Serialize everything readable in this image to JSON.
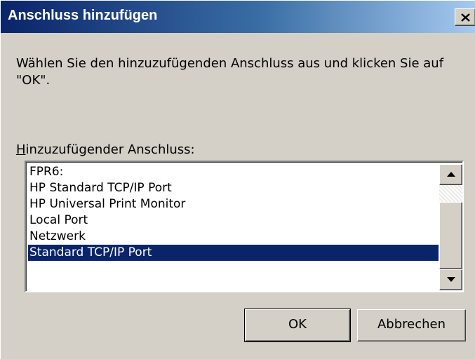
{
  "window": {
    "title": "Anschluss hinzufügen",
    "close_icon": "close-icon"
  },
  "instruction": "Wählen Sie den hinzuzufügenden Anschluss aus und klicken Sie auf \"OK\".",
  "field_label": {
    "mnemonic": "H",
    "rest": "inzuzufügender Anschluss:"
  },
  "ports": {
    "items": [
      "FPR6:",
      "HP Standard TCP/IP Port",
      "HP Universal Print Monitor",
      "Local Port",
      "Netzwerk",
      "Standard TCP/IP Port"
    ],
    "selected": "Standard TCP/IP Port"
  },
  "buttons": {
    "ok": "OK",
    "cancel": "Abbrechen"
  },
  "colors": {
    "selection": "#0a246a",
    "face": "#d4d0c8"
  }
}
